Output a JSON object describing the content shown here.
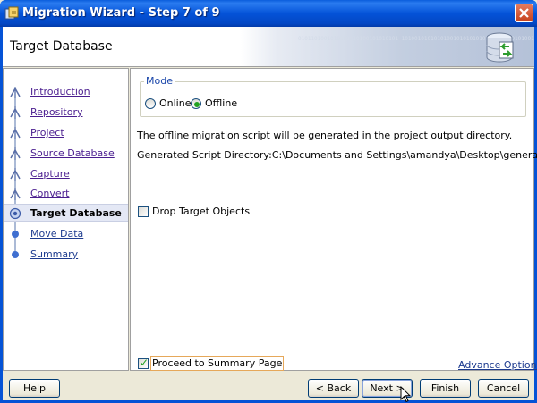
{
  "window": {
    "title": "Migration Wizard - Step 7 of 9"
  },
  "header": {
    "page_title": "Target Database",
    "banner_text": "0101101001010101010100101010101\n1010010101010100101010101010010\n0101010010101010101001010101010"
  },
  "nav": {
    "items": [
      {
        "label": "Introduction",
        "state": "visited"
      },
      {
        "label": "Repository",
        "state": "visited"
      },
      {
        "label": "Project",
        "state": "visited"
      },
      {
        "label": "Source Database",
        "state": "visited"
      },
      {
        "label": "Capture",
        "state": "visited"
      },
      {
        "label": "Convert",
        "state": "visited"
      },
      {
        "label": "Target Database",
        "state": "current"
      },
      {
        "label": "Move Data",
        "state": "future"
      },
      {
        "label": "Summary",
        "state": "future"
      }
    ]
  },
  "main": {
    "mode": {
      "legend": "Mode",
      "online_label": "Online",
      "offline_label": "Offline",
      "selected": "Offline"
    },
    "info_text": "The offline migration script will be generated in the project output directory.",
    "directory_text": "Generated Script Directory:C:\\Documents and Settings\\amandya\\Desktop\\generated",
    "drop_target_label": "Drop Target Objects",
    "drop_target_checked": false,
    "proceed_label": "Proceed to Summary Page",
    "proceed_checked": true,
    "advance_options_label": "Advance Options"
  },
  "footer": {
    "help_label": "Help",
    "back_label": "< Back",
    "next_label": "Next >",
    "finish_label": "Finish",
    "cancel_label": "Cancel"
  },
  "colors": {
    "titlebar": "#0453d8",
    "link_visited": "#4a1d8f",
    "link": "#1d3b8f",
    "check": "#21a121"
  }
}
